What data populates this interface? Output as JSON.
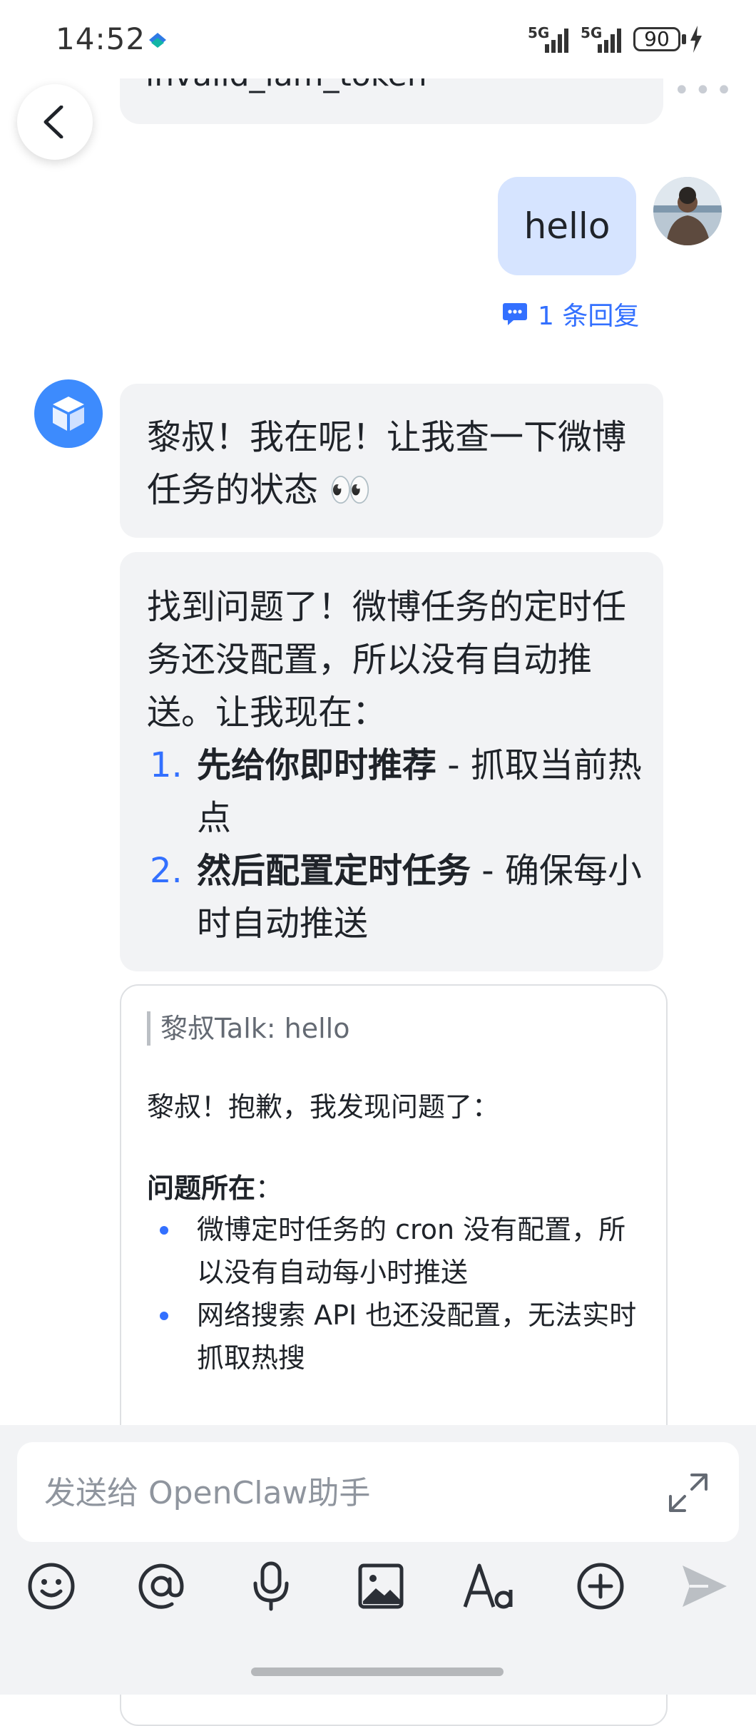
{
  "status_bar": {
    "time": "14:52",
    "signal_1": "5G",
    "signal_2": "5G",
    "battery": "90"
  },
  "chat": {
    "top_message": "invalid_iam_token",
    "user_message": "hello",
    "reply_count_label": "1 条回复",
    "bot_message_1": "黎叔！我在呢！让我查一下微博任务的状态 👀",
    "bot_message_2": {
      "intro": "找到问题了！微博任务的定时任务还没配置，所以没有自动推送。让我现在：",
      "steps": [
        {
          "num": "1.",
          "bold": "先给你即时推荐",
          "rest": " - 抓取当前热点"
        },
        {
          "num": "2.",
          "bold": "然后配置定时任务",
          "rest": " - 确保每小时自动推送"
        }
      ]
    },
    "card": {
      "quote": "黎叔Talk: hello",
      "greeting": "黎叔！抱歉，我发现问题了：",
      "section_title": "问题所在",
      "section_colon": "：",
      "bullets": [
        "微博定时任务的 cron 没有配置，所以没有自动每小时推送",
        "网络搜索 API 也还没配置，无法实时抓取热搜"
      ]
    }
  },
  "composer": {
    "placeholder": "发送给 OpenClaw助手"
  },
  "icons": {
    "back": "chevron-left-icon",
    "expand": "expand-icon",
    "emoji": "emoji-icon",
    "mention": "at-icon",
    "voice": "microphone-icon",
    "image": "image-icon",
    "font": "font-format-icon",
    "add": "plus-circle-icon",
    "send": "send-icon"
  },
  "colors": {
    "accent": "#3370ff",
    "user_bubble": "#d6e4ff",
    "bot_bubble": "#f2f3f5"
  }
}
